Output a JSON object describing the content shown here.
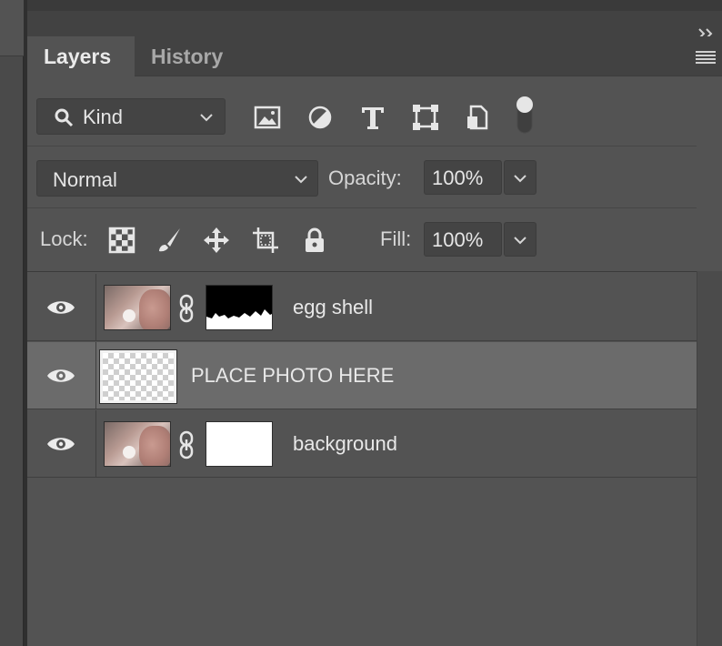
{
  "panel": {
    "tabs": [
      {
        "label": "Layers",
        "active": true
      },
      {
        "label": "History",
        "active": false
      }
    ]
  },
  "filter": {
    "kind_label": "Kind",
    "icons": [
      "image-filter-icon",
      "adjustment-filter-icon",
      "type-filter-icon",
      "shape-filter-icon",
      "smart-object-filter-icon",
      "filter-toggle-icon"
    ]
  },
  "blend": {
    "mode": "Normal",
    "opacity_label": "Opacity:",
    "opacity_value": "100%"
  },
  "lock": {
    "label": "Lock:",
    "icons": [
      "lock-transparent-pixels-icon",
      "lock-image-pixels-icon",
      "lock-position-icon",
      "lock-artboard-icon",
      "lock-all-icon"
    ],
    "fill_label": "Fill:",
    "fill_value": "100%"
  },
  "layers": [
    {
      "name": "egg shell",
      "visible": true,
      "selected": false,
      "thumbnail": "photo",
      "mask": "black-mask"
    },
    {
      "name": "PLACE PHOTO HERE",
      "visible": true,
      "selected": true,
      "thumbnail": "transparent"
    },
    {
      "name": "background",
      "visible": true,
      "selected": false,
      "thumbnail": "photo",
      "mask": "white-mask"
    }
  ],
  "colors": {
    "panel_bg": "#535353",
    "header_bg": "#424242",
    "selected_row": "#6b6b6b",
    "text": "#e8e8e8"
  }
}
